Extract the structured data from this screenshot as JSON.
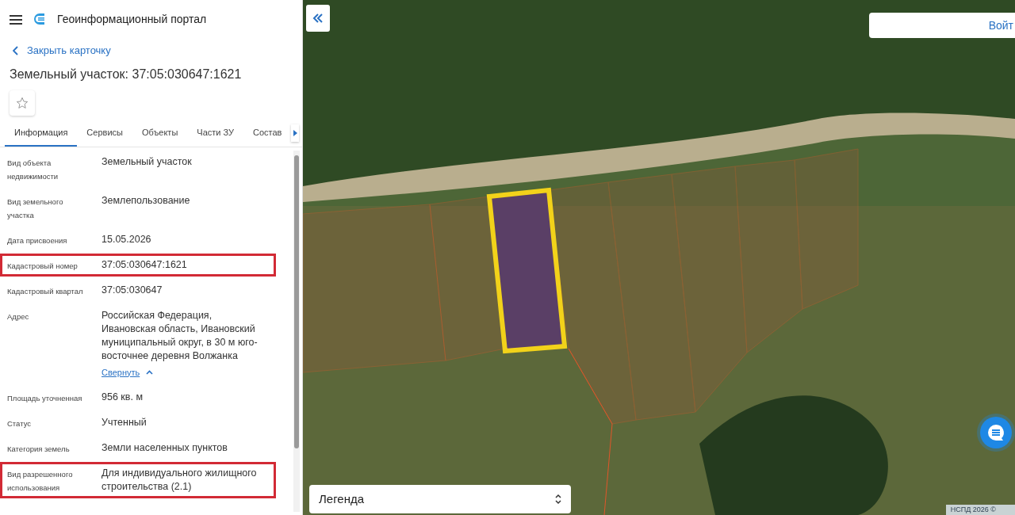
{
  "header": {
    "title": "Геоинформационный портал"
  },
  "back_link": "Закрыть карточку",
  "card_title": "Земельный участок: 37:05:030647:1621",
  "favorite": {
    "on": false
  },
  "tabs": [
    {
      "label": "Информация",
      "selected": true
    },
    {
      "label": "Сервисы",
      "selected": false
    },
    {
      "label": "Объекты",
      "selected": false
    },
    {
      "label": "Части ЗУ",
      "selected": false
    },
    {
      "label": "Состав",
      "selected": false
    }
  ],
  "fields": [
    {
      "label": "Вид объекта недвижимости",
      "value": "Земельный участок",
      "highlighted": false
    },
    {
      "label": "Вид земельного участка",
      "value": "Землепользование",
      "highlighted": false
    },
    {
      "label": "Дата присвоения",
      "value": "15.05.2026",
      "highlighted": false
    },
    {
      "label": "Кадастровый номер",
      "value": "37:05:030647:1621",
      "highlighted": true
    },
    {
      "label": "Кадастровый квартал",
      "value": "37:05:030647",
      "highlighted": false
    },
    {
      "label": "Адрес",
      "value": "Российская Федерация, Ивановская область, Ивановский муниципальный округ, в 30 м юго-восточнее деревня Волжанка",
      "link": "Свернуть",
      "highlighted": false
    },
    {
      "label": "Площадь уточненная",
      "value": "956 кв. м",
      "highlighted": false
    },
    {
      "label": "Статус",
      "value": "Учтенный",
      "highlighted": false
    },
    {
      "label": "Категория земель",
      "value": "Земли населенных пунктов",
      "highlighted": false
    },
    {
      "label": "Вид разрешенного использования",
      "value": "Для индивидуального жилищного строительства (2.1)",
      "highlighted": true
    }
  ],
  "map": {
    "login_button": "Войт",
    "legend": "Легенда",
    "attribution": "НСПД 2026 ©"
  }
}
